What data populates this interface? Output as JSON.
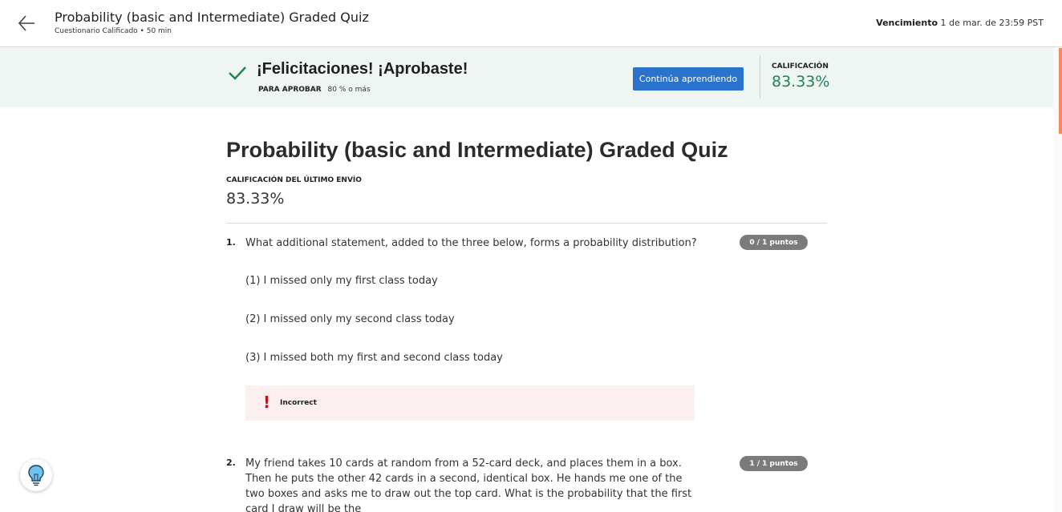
{
  "header": {
    "title": "Probability (basic and Intermediate) Graded Quiz",
    "subtitle": "Cuestionario Calificado • 50 min",
    "due_label": "Vencimiento",
    "due_value": "1 de mar. de 23:59 PST"
  },
  "banner": {
    "congrats": "¡Felicitaciones! ¡Aprobaste!",
    "pass_label": "PARA APROBAR",
    "pass_value": "80 % o más",
    "continue_label": "Continúa aprendiendo",
    "grade_label": "CALIFICACIÓN",
    "grade_value": "83.33%",
    "grade_color": "#1f8354",
    "button_color": "#2a73cc"
  },
  "main": {
    "title": "Probability (basic and Intermediate) Graded Quiz",
    "last_submission_label": "CALIFICACIÓN DEL ÚLTIMO ENVÍO",
    "last_submission_value": "83.33%"
  },
  "questions": [
    {
      "number": "1.",
      "text": "What additional statement, added to the three below, forms a probability distribution?",
      "points": "0 / 1 puntos",
      "options": [
        "(1) I missed only my first class today",
        "(2) I missed only my second class today",
        "(3) I missed both my first and second class today"
      ],
      "feedback": "Incorrect"
    },
    {
      "number": "2.",
      "text": "My friend takes 10 cards at random from a 52-card deck, and places them in a box. Then he puts the other 42 cards in a second, identical box. He hands me one of the two boxes and asks me to draw out the top card. What is the probability that the first card I draw will be the",
      "points": "1 / 1 puntos"
    }
  ],
  "icons": {
    "back": "arrow-left-icon",
    "check": "checkmark-icon",
    "feedback": "exclamation-icon",
    "help": "lightbulb-icon"
  }
}
